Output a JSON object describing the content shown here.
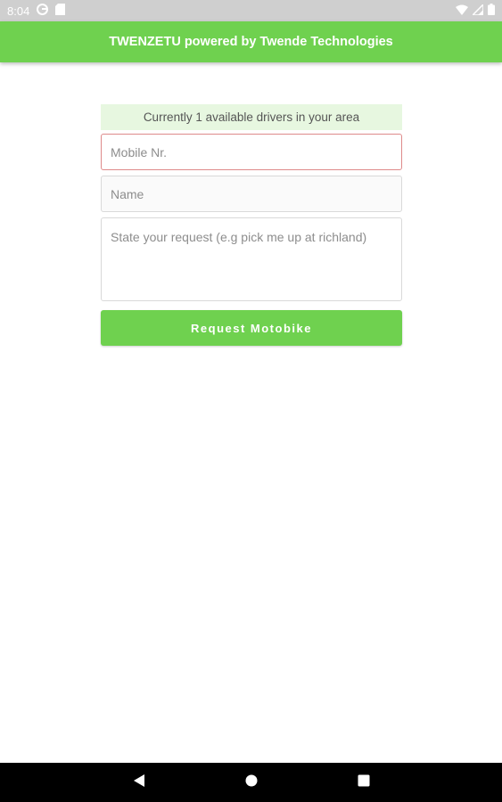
{
  "status_bar": {
    "time": "8:04",
    "icons_left": [
      "google-play-protect-icon",
      "sd-card-icon"
    ],
    "icons_right": [
      "wifi-icon",
      "signal-icon",
      "battery-icon"
    ]
  },
  "app_bar": {
    "title": "TWENZETU powered by Twende Technologies"
  },
  "form": {
    "drivers_banner": "Currently 1 available drivers in your area",
    "mobile_placeholder": "Mobile Nr.",
    "mobile_value": "",
    "name_placeholder": "Name",
    "name_value": "",
    "request_placeholder": "State your request (e.g pick me up at richland)",
    "request_value": "",
    "submit_label": "Request Motobike"
  },
  "nav_bar": {
    "icons": [
      "back-icon",
      "home-icon",
      "recents-icon"
    ]
  },
  "colors": {
    "accent": "#6fd14f",
    "banner_bg": "#e7f7e0",
    "error_border": "#de8a8a",
    "status_bar": "#cfcfcf"
  }
}
